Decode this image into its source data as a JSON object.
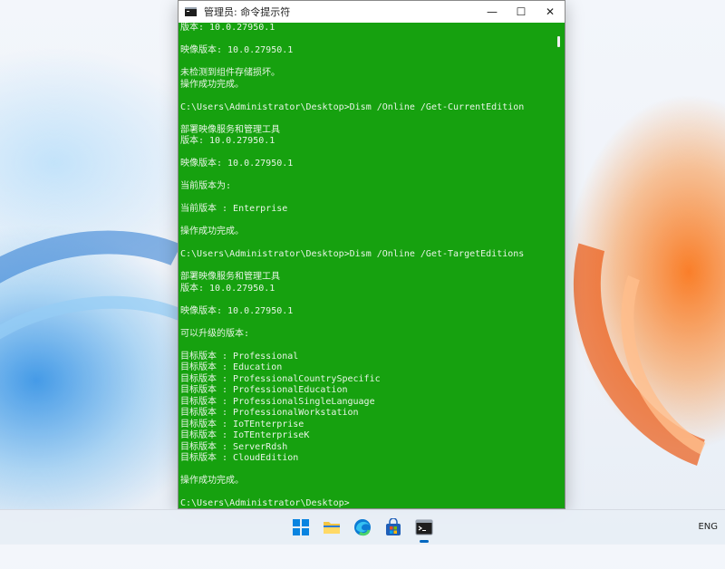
{
  "window": {
    "title": "管理员: 命令提示符",
    "controls": {
      "minimize": "—",
      "maximize": "☐",
      "close": "✕"
    },
    "background_color": "#16a10f",
    "text_color": "#e8f5e6"
  },
  "console_lines": [
    "版本: 10.0.27950.1",
    "",
    "映像版本: 10.0.27950.1",
    "",
    "未检测到组件存储损坏。",
    "操作成功完成。",
    "",
    "C:\\Users\\Administrator\\Desktop>Dism /Online /Get-CurrentEdition",
    "",
    "部署映像服务和管理工具",
    "版本: 10.0.27950.1",
    "",
    "映像版本: 10.0.27950.1",
    "",
    "当前版本为:",
    "",
    "当前版本 : Enterprise",
    "",
    "操作成功完成。",
    "",
    "C:\\Users\\Administrator\\Desktop>Dism /Online /Get-TargetEditions",
    "",
    "部署映像服务和管理工具",
    "版本: 10.0.27950.1",
    "",
    "映像版本: 10.0.27950.1",
    "",
    "可以升级的版本:",
    "",
    "目标版本 : Professional",
    "目标版本 : Education",
    "目标版本 : ProfessionalCountrySpecific",
    "目标版本 : ProfessionalEducation",
    "目标版本 : ProfessionalSingleLanguage",
    "目标版本 : ProfessionalWorkstation",
    "目标版本 : IoTEnterprise",
    "目标版本 : IoTEnterpriseK",
    "目标版本 : ServerRdsh",
    "目标版本 : CloudEdition",
    "",
    "操作成功完成。",
    "",
    "C:\\Users\\Administrator\\Desktop>"
  ],
  "taskbar": {
    "icons": [
      "start-icon",
      "file-explorer-icon",
      "edge-icon",
      "store-icon",
      "terminal-icon"
    ],
    "language": "ENG"
  }
}
